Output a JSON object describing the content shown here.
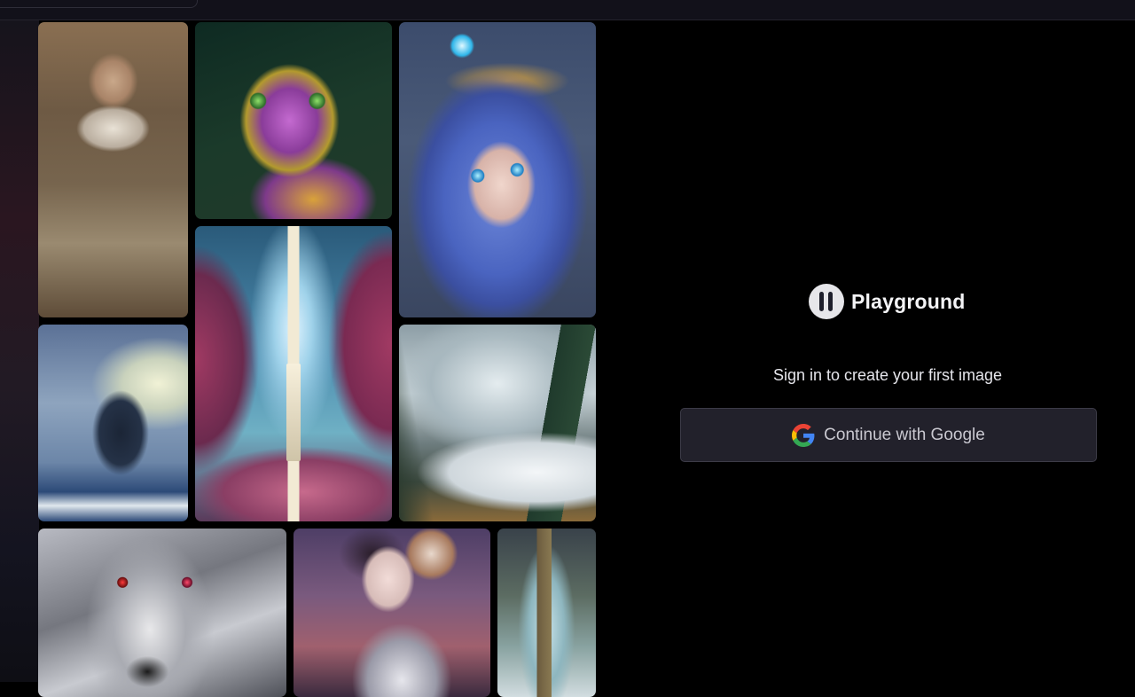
{
  "brand": {
    "name": "Playground"
  },
  "auth": {
    "prompt": "Sign in to create your first image",
    "google_button_label": "Continue with Google"
  },
  "gallery": {
    "tiles": [
      {
        "subject": "old man portrait"
      },
      {
        "subject": "ornate cat"
      },
      {
        "subject": "blue haired girl with flowers"
      },
      {
        "subject": "ship in storm"
      },
      {
        "subject": "lighthouse in fantasy sky"
      },
      {
        "subject": "snowy mountain landscape"
      },
      {
        "subject": "silver wolf"
      },
      {
        "subject": "robot girl"
      },
      {
        "subject": "tree in glass jar"
      }
    ]
  },
  "icons": {
    "brand": "playground-logo-icon",
    "google": "google-g-icon"
  },
  "colors": {
    "background": "#000000",
    "button_bg": "#22212b",
    "button_border": "#3c3b47",
    "brand_text": "#f4f4f6"
  }
}
